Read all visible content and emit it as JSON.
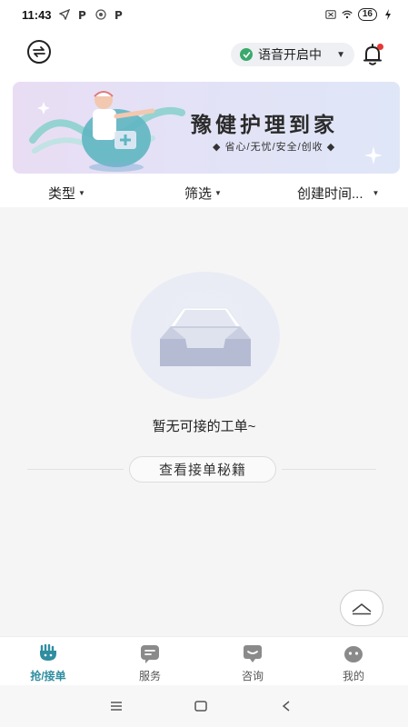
{
  "status_bar": {
    "time": "11:43",
    "battery": "16"
  },
  "header": {
    "voice_label": "语音开启中"
  },
  "banner": {
    "title": "豫健护理到家",
    "subtitle": "◆ 省心/无忧/安全/创收 ◆"
  },
  "filters": [
    {
      "label": "类型"
    },
    {
      "label": "筛选"
    },
    {
      "label": "创建时间..."
    }
  ],
  "empty_state": {
    "message": "暂无可接的工单~",
    "tips_button": "查看接单秘籍"
  },
  "tabs": [
    {
      "label": "抢/接单",
      "icon": "grab-order-icon",
      "active": true
    },
    {
      "label": "服务",
      "icon": "service-icon",
      "active": false
    },
    {
      "label": "咨询",
      "icon": "consult-icon",
      "active": false
    },
    {
      "label": "我的",
      "icon": "profile-icon",
      "active": false
    }
  ],
  "colors": {
    "accent": "#2f8ea0",
    "voice_on": "#3aaa6c",
    "notification_dot": "#e53935"
  }
}
